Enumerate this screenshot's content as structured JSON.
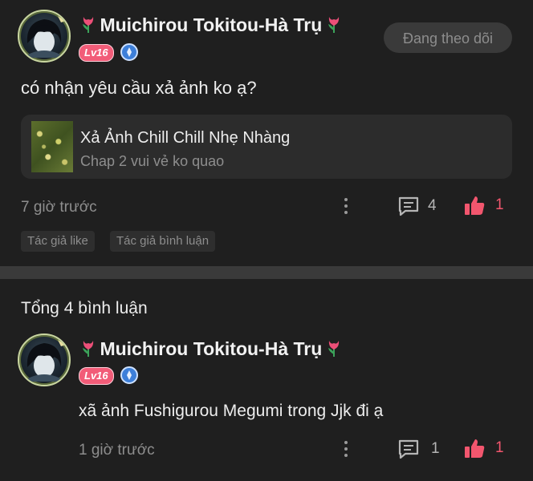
{
  "post": {
    "author": {
      "name": "Muichirou Tokitou-Hà Trụ",
      "level": "Lv16"
    },
    "follow_label": "Đang theo dõi",
    "text": "có nhận yêu cầu xả ảnh ko ạ?",
    "linked_manga": {
      "title": "Xả Ảnh Chill Chill Nhẹ Nhàng",
      "subtitle": "Chap 2 vui vẻ ko quao"
    },
    "time": "7 giờ trước",
    "comments": "4",
    "likes": "1",
    "tags": [
      "Tác giả like",
      "Tác giả bình luận"
    ]
  },
  "comments_section": {
    "total_label": "Tổng 4 bình luận",
    "comments": [
      {
        "author": {
          "name": "Muichirou Tokitou-Hà Trụ",
          "level": "Lv16"
        },
        "text": "xã ảnh Fushigurou Megumi trong Jjk đi ạ",
        "time": "1 giờ trước",
        "replies": "1",
        "likes": "1"
      }
    ]
  },
  "colors": {
    "background": "#1f1f1f",
    "accent_like": "#f2566e",
    "level_badge": "#f25c78",
    "verify_badge": "#3d7fd9"
  },
  "icons": [
    "tulip-icon",
    "verify-icon",
    "more-icon",
    "comment-icon",
    "like-icon"
  ]
}
